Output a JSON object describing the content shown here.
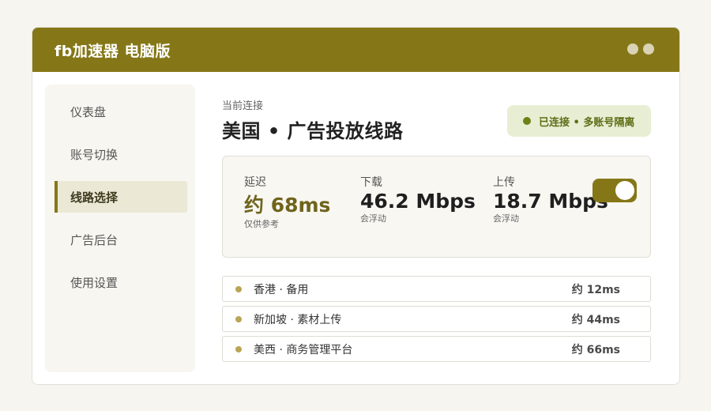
{
  "app": {
    "title": "fb加速器  电脑版"
  },
  "sidebar": {
    "items": [
      {
        "label": "仪表盘",
        "active": false
      },
      {
        "label": "账号切换",
        "active": false
      },
      {
        "label": "线路选择",
        "active": true
      },
      {
        "label": "广告后台",
        "active": false
      },
      {
        "label": "使用设置",
        "active": false
      }
    ]
  },
  "main": {
    "crumb": "当前连接",
    "route_title": "美国 • 广告投放线路",
    "status": "已连接 • 多账号隔离"
  },
  "stats": {
    "latency": {
      "label": "延迟",
      "value": "约 68ms",
      "note": "仅供参考"
    },
    "download": {
      "label": "下载",
      "value": "46.2 Mbps",
      "note": "会浮动"
    },
    "upload": {
      "label": "上传",
      "value": "18.7 Mbps",
      "note": "会浮动"
    },
    "toggle_on": true
  },
  "nodes": [
    {
      "name": "香港 · 备用",
      "latency": "约 12ms"
    },
    {
      "name": "新加坡 · 素材上传",
      "latency": "约 44ms"
    },
    {
      "name": "美西 · 商务管理平台",
      "latency": "约 66ms"
    }
  ],
  "colors": {
    "brand": "#857717",
    "status_bg": "#e8eed3",
    "status_text": "#5b6e16",
    "node_dot": "#b9a554"
  }
}
